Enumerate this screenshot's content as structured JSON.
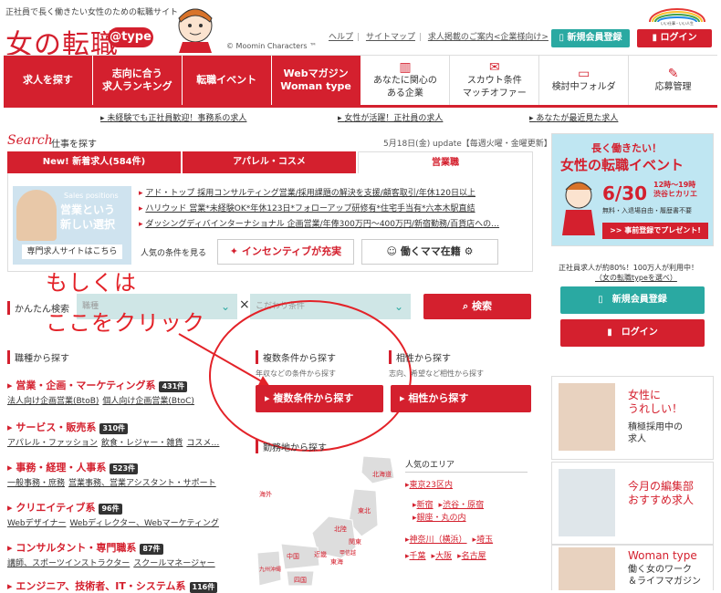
{
  "header": {
    "tagline": "正社員で長く働きたい女性のための転職サイト",
    "logo": "女の転職",
    "logo_badge": "@type",
    "copyright": "© Moomin Characters ™",
    "top_links": [
      "ヘルプ",
      "サイトマップ",
      "求人掲載のご案内<企業様向け>"
    ],
    "register": "新規会員登録",
    "login": "ログイン",
    "rainbow_caption": "いい仕事・いい人生",
    "accent": "#d4202e",
    "teal": "#2aa9a2"
  },
  "nav": {
    "items": [
      {
        "label": "求人を探す",
        "icon": ""
      },
      {
        "label": "志向に合う\n求人ランキング",
        "icon": ""
      },
      {
        "label": "転職イベント",
        "icon": ""
      },
      {
        "label": "Webマガジン\nWoman type",
        "icon": ""
      },
      {
        "label": "あなたに関心の\nある企業",
        "icon": "building-icon"
      },
      {
        "label": "スカウト条件\nマッチオファー",
        "icon": "mail-icon"
      },
      {
        "label": "検討中フォルダ",
        "icon": "folder-icon"
      },
      {
        "label": "応募管理",
        "icon": "memo-icon"
      }
    ]
  },
  "subnav": [
    "未経験でも正社員歓迎！事務系の求人",
    "女性が活躍！正社員の求人",
    "あなたが最近見た求人"
  ],
  "search": {
    "title": "Search",
    "subtitle": "仕事を探す",
    "update": "5月18日(金) update【毎週火曜・金曜更新】",
    "tabs": [
      "New! 新着求人(584件)",
      "アパレル・コスメ",
      "営業職"
    ],
    "promo_en": "Sales positions",
    "promo_jp": "営業という\n新しい選択",
    "promo_btn": "専門求人サイトはこちら",
    "jobs": [
      "アド・トップ 採用コンサルティング営業/採用課題の解決を支援/顧客取引/年休120日以上",
      "ハリウッド 営業*未経験OK*年休123日*フォローアップ研修有*住宅手当有*六本木駅直結",
      "ダッシングディバインターナショナル 企画営業/年俸300万円〜400万円/新宿勤務/百貨店への…"
    ],
    "popular_label": "人気の条件を見る",
    "chip1": "インセンティブが充実",
    "chip2": "働くママ在籍",
    "quick_label": "かんたん検索",
    "select1": "職種",
    "select2": "こだわり条件",
    "search_btn": "検索"
  },
  "overlay": {
    "line1": "もしくは",
    "line2": "ここをクリック"
  },
  "categories": {
    "title": "職種から探す",
    "items": [
      {
        "name": "営業・企画・マーケティング系",
        "count": "431件",
        "subs": [
          "法人向け企画営業(BtoB)",
          "個人向け企画営業(BtoC)"
        ]
      },
      {
        "name": "サービス・販売系",
        "count": "310件",
        "subs": [
          "アパレル・ファッション",
          "飲食・レジャー・雑貨",
          "コスメ…"
        ]
      },
      {
        "name": "事務・経理・人事系",
        "count": "523件",
        "subs": [
          "一般事務・庶務",
          "営業事務、営業アシスタント・サポート"
        ]
      },
      {
        "name": "クリエイティブ系",
        "count": "96件",
        "subs": [
          "Webデザイナー",
          "Webディレクター、Webマーケティング"
        ]
      },
      {
        "name": "コンサルタント・専門職系",
        "count": "87件",
        "subs": [
          "講師、スポーツインストラクター",
          "スクールマネージャー"
        ]
      },
      {
        "name": "エンジニア、技術者、IT・システム系",
        "count": "116件",
        "subs": []
      }
    ]
  },
  "multi": {
    "title": "複数条件から探す",
    "desc": "年収などの条件から探す",
    "btn": "複数条件から探す"
  },
  "compat": {
    "title": "相性から探す",
    "desc": "志向、希望など相性から探す",
    "btn": "相性から探す"
  },
  "location": {
    "title": "勤務地から探す",
    "map_labels": [
      "北海道",
      "東北",
      "北陸",
      "関東",
      "甲信越",
      "中国",
      "近畿",
      "東海",
      "四国",
      "九州沖縄",
      "海外"
    ],
    "area_title": "人気のエリア",
    "areas": [
      [
        "東京23区内"
      ],
      [
        "新宿",
        "渋谷・原宿"
      ],
      [
        "銀座・丸の内"
      ],
      [
        "神奈川（横浜）",
        "埼玉"
      ],
      [
        "千葉",
        "大阪",
        "名古屋"
      ]
    ]
  },
  "sidebar": {
    "event_t1": "長く働きたい！",
    "event_t2": "女性の転職イベント",
    "event_date": "6/30",
    "event_time": "12時〜19時\n渋谷ヒカリエ",
    "event_free": "無料・入退場自由・履歴書不要",
    "event_btn": ">> 事前登録でプレゼント!",
    "note_line1": "正社員求人が約80%！100万人が利用中！",
    "note_line2": "（女の転職typeを選べ）",
    "register": "新規会員登録",
    "login": "ログイン",
    "cards": [
      {
        "title": "女性に\nうれしい！",
        "sub": "積極採用中の\n求人"
      },
      {
        "title": "今月の編集部\nおすすめ求人",
        "sub": ""
      },
      {
        "title": "Woman type",
        "sub": "働く女のワーク\n＆ライフマガジン"
      }
    ]
  }
}
